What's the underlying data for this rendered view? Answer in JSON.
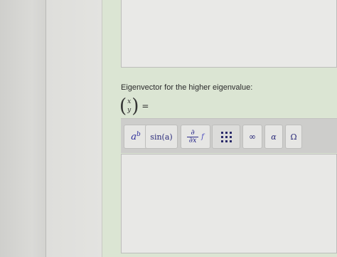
{
  "question": {
    "prompt": "Eigenvector for the higher eigenvalue:",
    "vector_top": "x",
    "vector_bottom": "y",
    "equals": "="
  },
  "toolbar": {
    "power_base": "a",
    "power_exp": "b",
    "sin_label": "sin(a)",
    "partial_top": "∂",
    "partial_bottom": "∂x",
    "partial_f": "f",
    "infinity": "∞",
    "alpha": "α",
    "omega": "Ω"
  },
  "icons": [
    "matrix-icon"
  ]
}
